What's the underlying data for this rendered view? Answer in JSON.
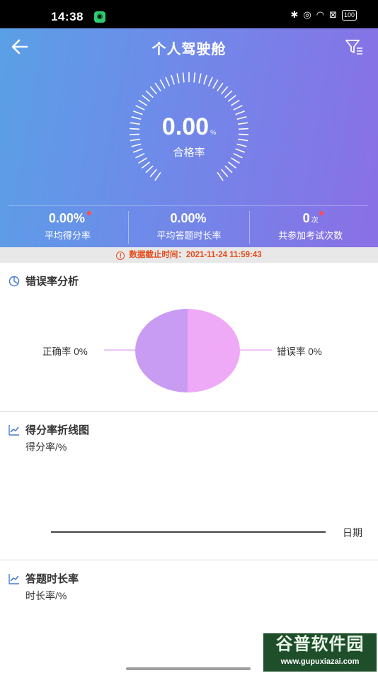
{
  "status_bar": {
    "time": "14:38",
    "battery": "100"
  },
  "header": {
    "title": "个人驾驶舱",
    "gauge_value": "0.00",
    "gauge_unit": "%",
    "gauge_label": "合格率"
  },
  "stats": [
    {
      "value": "0.00%",
      "unit": "",
      "label": "平均得分率"
    },
    {
      "value": "0.00%",
      "unit": "",
      "label": "平均答题时长率"
    },
    {
      "value": "0",
      "unit": "次",
      "label": "共参加考试次数"
    }
  ],
  "notice": {
    "text": "数据截止时间：2021-11-24 11:59:43"
  },
  "error_analysis": {
    "title": "错误率分析",
    "correct_label": "正确率 0%",
    "wrong_label": "错误率 0%"
  },
  "score_chart": {
    "title": "得分率折线图",
    "ylabel": "得分率/%",
    "xlabel": "日期"
  },
  "time_chart": {
    "title": "答题时长率",
    "ylabel": "时长率/%"
  },
  "chart_data": [
    {
      "type": "pie",
      "title": "错误率分析",
      "categories": [
        "正确率",
        "错误率"
      ],
      "values": [
        0,
        0
      ],
      "colors": [
        "#c99cf4",
        "#eeaaf7"
      ]
    },
    {
      "type": "line",
      "title": "得分率折线图",
      "ylabel": "得分率/%",
      "xlabel": "日期",
      "x": [],
      "series": []
    },
    {
      "type": "line",
      "title": "答题时长率",
      "ylabel": "时长率/%",
      "x": [],
      "series": []
    }
  ],
  "watermark": {
    "main": "谷普软件园",
    "url": "www.gupuxiazai.com"
  },
  "colors": {
    "header_start": "#5aa0e6",
    "header_end": "#8a6fe6",
    "notice": "#e64a19",
    "pie_left": "#c99cf4",
    "pie_right": "#eeaaf7"
  }
}
